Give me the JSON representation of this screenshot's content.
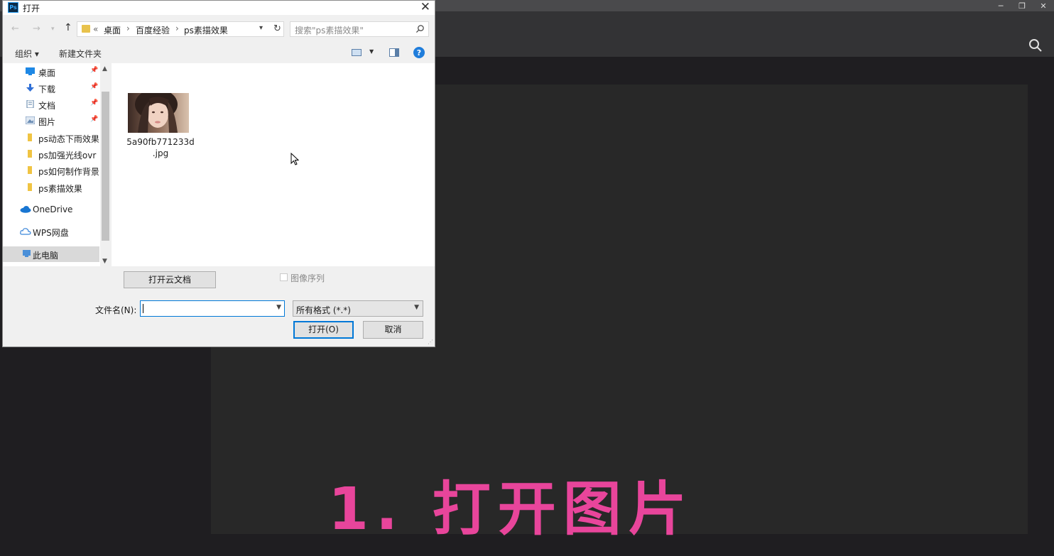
{
  "dialog": {
    "title": "打开",
    "app_badge": "Ps",
    "breadcrumb": [
      "«",
      "桌面",
      "百度经验",
      "ps素描效果"
    ],
    "search_placeholder": "搜索\"ps素描效果\"",
    "toolbar": {
      "organize": "组织 ▾",
      "new_folder": "新建文件夹",
      "help": "?"
    },
    "nav_items": [
      {
        "label": "桌面",
        "pinned": true,
        "icon": "desktop-icon"
      },
      {
        "label": "下载",
        "pinned": true,
        "icon": "download-icon"
      },
      {
        "label": "文档",
        "pinned": true,
        "icon": "document-icon"
      },
      {
        "label": "图片",
        "pinned": true,
        "icon": "picture-icon"
      },
      {
        "label": "ps动态下雨效果",
        "pinned": false,
        "icon": "folder-icon"
      },
      {
        "label": "ps加强光线ovr",
        "pinned": false,
        "icon": "folder-icon"
      },
      {
        "label": "ps如何制作背景",
        "pinned": false,
        "icon": "folder-icon"
      },
      {
        "label": "ps素描效果",
        "pinned": false,
        "icon": "folder-icon"
      },
      {
        "label": "OneDrive",
        "pinned": false,
        "icon": "onedrive-icon"
      },
      {
        "label": "WPS网盘",
        "pinned": false,
        "icon": "cloud-icon"
      },
      {
        "label": "此电脑",
        "pinned": false,
        "icon": "computer-icon",
        "selected": true
      }
    ],
    "files": [
      {
        "name_line1": "5a90fb771233d",
        "name_line2": ".jpg"
      }
    ],
    "open_cloud_doc": "打开云文档",
    "image_sequence": "图像序列",
    "filename_label": "文件名(N):",
    "filename_value": "",
    "format_value": "所有格式 (*.*)",
    "open_button": "打开(O)",
    "cancel_button": "取消"
  },
  "caption": "1. 打开图片",
  "colors": {
    "caption": "#e8459b",
    "accent": "#0078d7",
    "ps_bg": "#1f1e21"
  }
}
